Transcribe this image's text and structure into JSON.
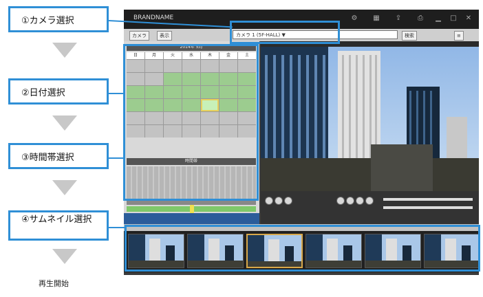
{
  "steps": [
    {
      "label": "①カメラ選択"
    },
    {
      "label": "②日付選択"
    },
    {
      "label": "③時間帯選択"
    },
    {
      "label": "④サムネイル選択"
    }
  ],
  "play_start": "再生開始",
  "app": {
    "title": "BRANDNAME",
    "toolbar": {
      "btn_a": "カメラ",
      "btn_b": "表示",
      "camera_value": "カメラ 1 (5F-HALL) ▼",
      "btn_search": "検索"
    },
    "calendar": {
      "header": "2014年 5月",
      "weekdays": [
        "日",
        "月",
        "火",
        "水",
        "木",
        "金",
        "土"
      ]
    },
    "time_header": "時間帯",
    "colors": {
      "accent": "#2f8fd6",
      "recorded": "#9ccc8f",
      "selected_border": "#e8d05a",
      "window_bg": "#3b3b3b"
    }
  }
}
